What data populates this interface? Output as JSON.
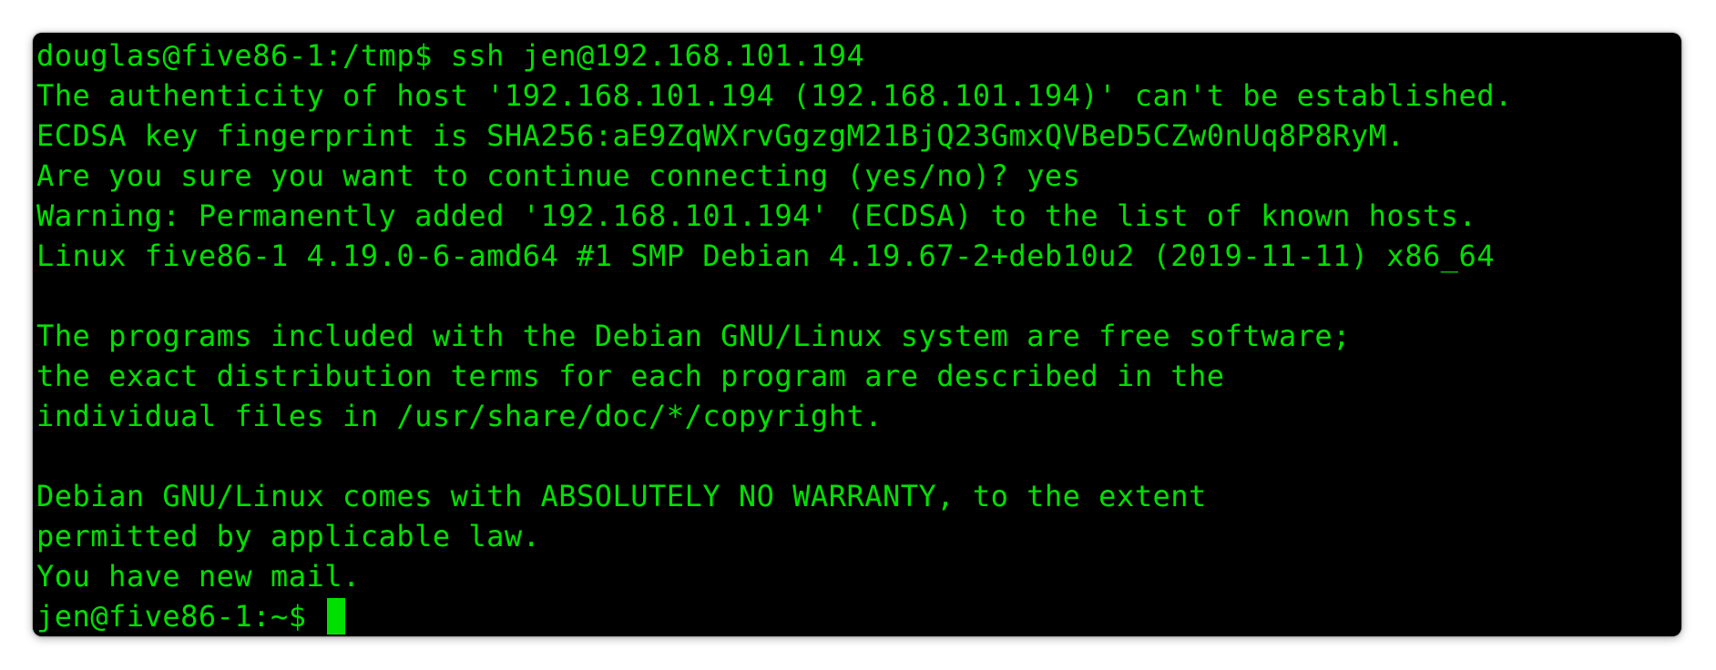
{
  "terminal": {
    "lines": [
      "douglas@five86-1:/tmp$ ssh jen@192.168.101.194",
      "The authenticity of host '192.168.101.194 (192.168.101.194)' can't be established.",
      "ECDSA key fingerprint is SHA256:aE9ZqWXrvGgzgM21BjQ23GmxQVBeD5CZw0nUq8P8RyM.",
      "Are you sure you want to continue connecting (yes/no)? yes",
      "Warning: Permanently added '192.168.101.194' (ECDSA) to the list of known hosts.",
      "Linux five86-1 4.19.0-6-amd64 #1 SMP Debian 4.19.67-2+deb10u2 (2019-11-11) x86_64",
      "",
      "The programs included with the Debian GNU/Linux system are free software;",
      "the exact distribution terms for each program are described in the",
      "individual files in /usr/share/doc/*/copyright.",
      "",
      "Debian GNU/Linux comes with ABSOLUTELY NO WARRANTY, to the extent",
      "permitted by applicable law.",
      "You have new mail."
    ],
    "prompt": "jen@five86-1:~$ ",
    "colors": {
      "background": "#000000",
      "text": "#00e000",
      "cursor": "#00e000"
    }
  }
}
